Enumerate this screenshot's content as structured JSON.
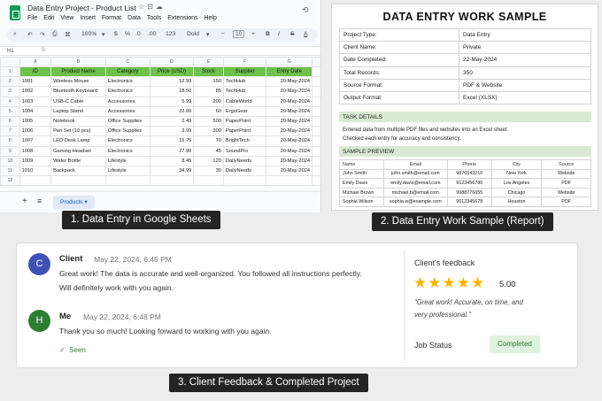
{
  "panels": {
    "sheets": {
      "doc_title": "Data Entry Project - Product List",
      "menu": [
        "File",
        "Edit",
        "View",
        "Insert",
        "Format",
        "Data",
        "Tools",
        "Extensions",
        "Help"
      ],
      "toolbar": {
        "zoom": "100%",
        "currency": "$",
        "percent": "%",
        "decimal_decrease": ".0",
        "decimal_increase": ".00",
        "number_format": "123",
        "font_name": "Dold",
        "font_size": "10",
        "bold": "B",
        "italic": "I",
        "strike": "S",
        "text_color": "A"
      },
      "cell_ref": "H1",
      "formula_icon": "fx",
      "column_letters": [
        "A",
        "B",
        "C",
        "D",
        "E",
        "F",
        "G"
      ],
      "row_numbers": [
        "1",
        "2",
        "3",
        "4",
        "5",
        "6",
        "7",
        "8",
        "9",
        "10",
        "11",
        "12"
      ],
      "headers": [
        "ID",
        "Product Name",
        "Category",
        "Price (USD)",
        "Stock",
        "Supplier",
        "Entry Date"
      ],
      "rows": [
        [
          "1001",
          "Wireless Mouse",
          "Electronics",
          "12.99",
          "150",
          "TechHub",
          "20-May-2024"
        ],
        [
          "1002",
          "Bluetooth Keyboard",
          "Electronics",
          "18.50",
          "85",
          "TechHub",
          "20-May-2024"
        ],
        [
          "1003",
          "USB-C Cable",
          "Accessories",
          "5.99",
          "200",
          "CableWorld",
          "20-May-2024"
        ],
        [
          "1004",
          "Laptop Stand",
          "Accessories",
          "22.00",
          "60",
          "ErgoGear",
          "20-May-2024"
        ],
        [
          "1005",
          "Notebook",
          "Office Supplies",
          "2.49",
          "500",
          "PaperPoint",
          "20-May-2024"
        ],
        [
          "1006",
          "Pen Set (10 pcs)",
          "Office Supplies",
          "3.99",
          "300",
          "PaperPoint",
          "20-May-2024"
        ],
        [
          "1007",
          "LED Desk Lamp",
          "Electronics",
          "15.75",
          "70",
          "BrightTech",
          "20-May-2024"
        ],
        [
          "1008",
          "Gaming Headset",
          "Electronics",
          "27.90",
          "45",
          "SoundPro",
          "20-May-2024"
        ],
        [
          "1009",
          "Water Bottle",
          "Lifestyle",
          "8.45",
          "120",
          "DailyNeeds",
          "20-May-2024"
        ],
        [
          "1010",
          "Backpack",
          "Lifestyle",
          "34.99",
          "30",
          "DailyNeeds",
          "20-May-2024"
        ]
      ],
      "sheet_tab": "Products",
      "caption": "1. Data Entry in Google Sheets"
    },
    "report": {
      "title": "DATA ENTRY WORK SAMPLE",
      "info": [
        {
          "label": "Project Type:",
          "value": "Data Entry"
        },
        {
          "label": "Client Name:",
          "value": "Private"
        },
        {
          "label": "Date Completed:",
          "value": "22-May-2024"
        },
        {
          "label": "Total Records:",
          "value": "350"
        },
        {
          "label": "Source Format:",
          "value": "PDF & Website"
        },
        {
          "label": "Output Format:",
          "value": "Excel (XLSX)"
        }
      ],
      "task_heading": "TASK DETAILS",
      "task_lines": [
        "Entered data from multiple PDF files and websites into an Excel sheet.",
        "Checked each entry for accuracy and consistency."
      ],
      "preview_heading": "SAMPLE PREVIEW",
      "preview_headers": [
        "Name",
        "Email",
        "Phone",
        "City",
        "Source"
      ],
      "preview_rows": [
        [
          "John Smith",
          "john.smith@email.com",
          "9876543210",
          "New York",
          "Website"
        ],
        [
          "Emily Davis",
          "emily.davis@email.com",
          "9123456780",
          "Los Angeles",
          "PDF"
        ],
        [
          "Michael Brown",
          "michael.b@email.com",
          "9988776655",
          "Chicago",
          "Website"
        ],
        [
          "Sophia Wilson",
          "sophia.w@example.com",
          "9012345678",
          "Houston",
          "PDF"
        ]
      ],
      "caption": "2. Data Entry Work Sample (Report)"
    },
    "feedback": {
      "messages": [
        {
          "initial": "C",
          "name": "Client",
          "date": "May 22, 2024, 6:45 PM",
          "lines": [
            "Great work! The data is accurate and well-organized. You followed all instructions perfectly.",
            "Will definitely work with you again."
          ],
          "avatar_color": "#3f51b5"
        },
        {
          "initial": "H",
          "name": "Me",
          "date": "May 22, 2024, 6:48 PM",
          "lines": [
            "Thank you so much! Looking forward to working with you again."
          ],
          "avatar_color": "#2e7d32"
        }
      ],
      "seen": "Seen",
      "client_feedback_title": "Client's feedback",
      "stars": 5,
      "rating": "5.00",
      "quote_lines": [
        "“Great work! Accurate, on time, and",
        "very professional.”"
      ],
      "job_status_label": "Job Status",
      "job_status": "Completed",
      "caption": "3. Client Feedback & Completed Project"
    }
  },
  "colors": {
    "header_green": "#6cc24a",
    "section_green": "#d9ead3",
    "star": "#f7b500",
    "caption_bg": "#242424"
  }
}
